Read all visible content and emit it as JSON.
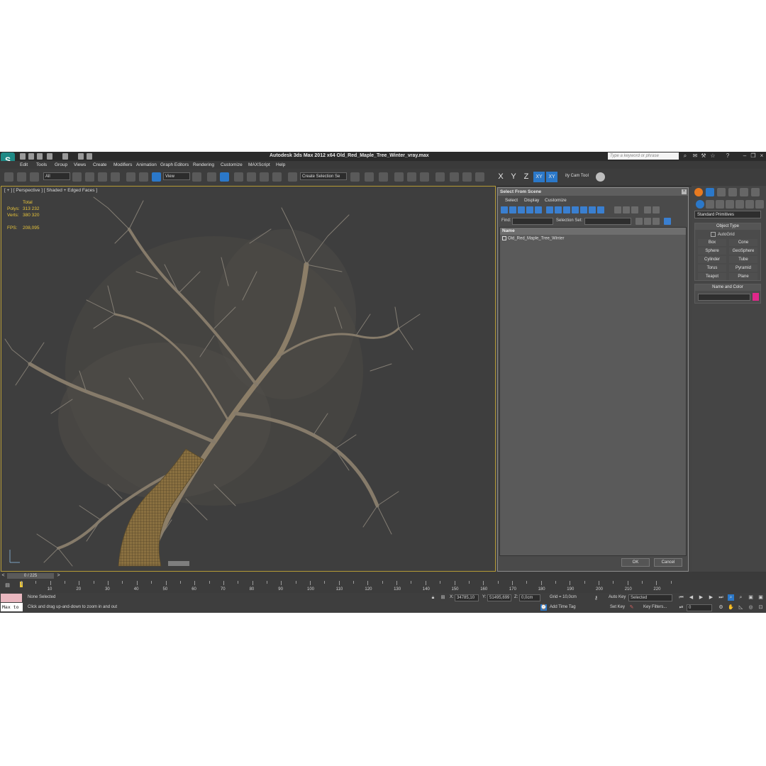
{
  "window": {
    "title": "Autodesk 3ds Max  2012 x64     Old_Red_Maple_Tree_Winter_vray.max",
    "search_placeholder": "Type a keyword or phrase"
  },
  "menu": [
    "Edit",
    "Tools",
    "Group",
    "Views",
    "Create",
    "Modifiers",
    "Animation",
    "Graph Editors",
    "Rendering",
    "Customize",
    "MAXScript",
    "Help"
  ],
  "toolbar": {
    "selection_filter": "All",
    "reference_coord": "View",
    "selection_set": "Create Selection Se",
    "axes": [
      "X",
      "Y",
      "Z",
      "XY",
      "XY"
    ],
    "utility_label": "ity Cam Tool"
  },
  "viewport": {
    "label": "[ + ] [ Perspective ] [ Shaded + Edged Faces ]",
    "stats": {
      "header": "Total",
      "polys_label": "Polys:",
      "polys": "313 232",
      "verts_label": "Verts:",
      "verts": "380 320",
      "fps_label": "FPS:",
      "fps": "208,095"
    }
  },
  "dialog": {
    "title": "Select From Scene",
    "menu": [
      "Select",
      "Display",
      "Customize"
    ],
    "find_label": "Find:",
    "selection_set_label": "Selection Set:",
    "column_name": "Name",
    "items": [
      "Old_Red_Maple_Tree_Winter"
    ],
    "ok": "OK",
    "cancel": "Cancel"
  },
  "command_panel": {
    "category": "Standard Primitives",
    "object_type_title": "Object Type",
    "autogrid": "AutoGrid",
    "primitives": [
      "Box",
      "Cone",
      "Sphere",
      "GeoSphere",
      "Cylinder",
      "Tube",
      "Torus",
      "Pyramid",
      "Teapot",
      "Plane"
    ],
    "name_color_title": "Name and Color",
    "object_color": "#e0288a"
  },
  "timeline": {
    "frame": "0 / 225",
    "ticks": [
      "10",
      "20",
      "30",
      "40",
      "50",
      "60",
      "70",
      "80",
      "90",
      "100",
      "110",
      "120",
      "130",
      "140",
      "150",
      "160",
      "170",
      "180",
      "190",
      "200",
      "210",
      "220"
    ]
  },
  "status": {
    "selection": "None Selected",
    "prompt": "Click and drag up-and-down to zoom in and out",
    "x_label": "X:",
    "x": "34785,10",
    "y_label": "Y:",
    "y": "51495,699",
    "z_label": "Z:",
    "z": "0,0cm",
    "grid": "Grid = 10,0cm",
    "auto_key": "Auto Key",
    "set_key": "Set Key",
    "key_mode": "Selected",
    "key_filters": "Key Filters...",
    "add_time_tag": "Add Time Tag",
    "current_frame": "0",
    "maxscript": "Max to"
  },
  "colors": {
    "viewport_bg": "#3e3e3e",
    "active_border": "#b59a35",
    "stats_text": "#e8c43a",
    "accent_blue": "#2b78c9"
  }
}
